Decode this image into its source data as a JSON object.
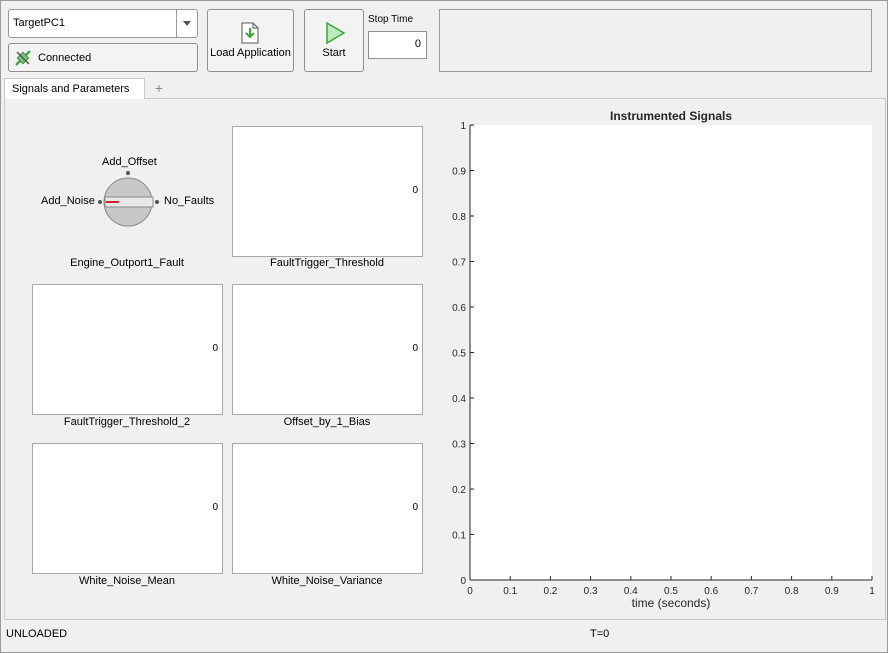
{
  "toolbar": {
    "target_value": "TargetPC1",
    "connect_label": "Connected",
    "load_label": "Load Application",
    "start_label": "Start",
    "stop_time_label": "Stop Time",
    "stop_time_value": "0"
  },
  "tabs": {
    "active_label": "Signals and Parameters",
    "add_label": "+"
  },
  "widgets": {
    "knob": {
      "top_option": "Add_Offset",
      "left_option": "Add_Noise",
      "right_option": "No_Faults",
      "label": "Engine_Outport1_Fault"
    },
    "cards": [
      {
        "value": "0",
        "label": "FaultTrigger_Threshold"
      },
      {
        "value": "0",
        "label": "FaultTrigger_Threshold_2"
      },
      {
        "value": "0",
        "label": "Offset_by_1_Bias"
      },
      {
        "value": "0",
        "label": "White_Noise_Mean"
      },
      {
        "value": "0",
        "label": "White_Noise_Variance"
      }
    ]
  },
  "status": {
    "app_state": "UNLOADED",
    "time": "T=0"
  },
  "colors": {
    "start_green": "#3aa63a",
    "knob_indicator": "#d32020",
    "connected_icon": "#4aa04a"
  },
  "chart_data": {
    "type": "line",
    "title": "Instrumented Signals",
    "xlabel": "time (seconds)",
    "ylabel": "",
    "xlim": [
      0,
      1
    ],
    "ylim": [
      0,
      1
    ],
    "xticks": [
      "0",
      "0.1",
      "0.2",
      "0.3",
      "0.4",
      "0.5",
      "0.6",
      "0.7",
      "0.8",
      "0.9",
      "1"
    ],
    "yticks": [
      "0",
      "0.1",
      "0.2",
      "0.3",
      "0.4",
      "0.5",
      "0.6",
      "0.7",
      "0.8",
      "0.9",
      "1"
    ],
    "grid": false,
    "series": []
  }
}
